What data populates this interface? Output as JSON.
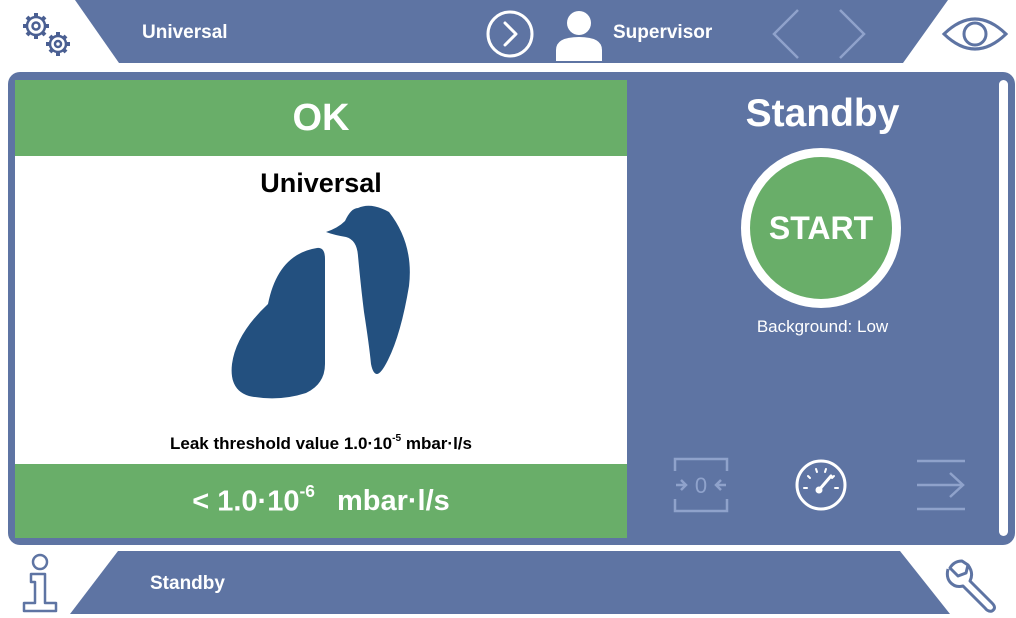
{
  "topbar": {
    "title": "Universal",
    "user": "Supervisor"
  },
  "result": {
    "status": "OK",
    "mode": "Universal",
    "threshold_prefix": "Leak threshold value 1.0·10",
    "threshold_exp": "-5",
    "threshold_unit": " mbar·l/s",
    "leakrate_prefix": "< 1.0·10",
    "leakrate_exp": "-6",
    "leakrate_unit": "mbar·l/s"
  },
  "control": {
    "state": "Standby",
    "start_label": "START",
    "background": "Background: Low"
  },
  "bottombar": {
    "status": "Standby"
  },
  "icons": {
    "top_left": "settings-gears-icon",
    "next": "circle-chevron-right-icon",
    "user": "user-icon",
    "nav_left": "chevron-left-icon",
    "nav_right": "chevron-right-icon",
    "view": "eye-icon",
    "zero": "zero-icon",
    "gauge": "gauge-icon",
    "exit": "exit-icon",
    "info": "info-icon",
    "service": "wrench-icon"
  },
  "colors": {
    "panel": "#5E74A3",
    "ok_green": "#69AE69",
    "logo_blue": "#23507F",
    "icon_blue": "#4A6FA5"
  }
}
